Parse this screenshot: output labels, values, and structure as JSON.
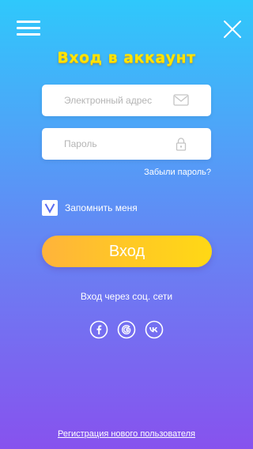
{
  "header": {
    "menu_icon": "hamburger-menu-icon",
    "close_icon": "close-icon",
    "title": "Вход в аккаунт"
  },
  "form": {
    "email": {
      "value": "",
      "placeholder": "Электронный адрес",
      "icon": "envelope-icon"
    },
    "password": {
      "value": "",
      "placeholder": "Пароль",
      "icon": "lock-icon"
    },
    "forgot_label": "Забыли пароль?",
    "remember": {
      "checked": true,
      "label": "Запомнить меня"
    },
    "submit_label": "Вход"
  },
  "social": {
    "label": "Вход через соц. сети",
    "networks": [
      {
        "icon": "facebook-icon",
        "glyph": "f"
      },
      {
        "icon": "google-icon",
        "glyph": "G"
      },
      {
        "icon": "vk-icon",
        "glyph": "vk"
      }
    ]
  },
  "footer": {
    "register_label": "Регистрация нового пользователя"
  },
  "colors": {
    "gradient_top": "#2fc8fb",
    "gradient_bottom": "#8752ee",
    "title_yellow": "#ffe500",
    "button_start": "#ffb33b",
    "button_end": "#ffd815",
    "checkbox_mark": "#5b6df0"
  }
}
